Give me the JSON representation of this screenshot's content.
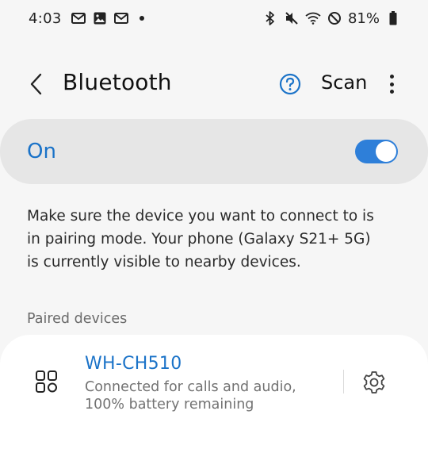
{
  "status_bar": {
    "time": "4:03",
    "left_icons": [
      "gmail-icon",
      "gallery-icon",
      "gmail-icon"
    ],
    "right_icons": [
      "bluetooth-icon",
      "mute-icon",
      "wifi-icon",
      "do-not-disturb-icon"
    ],
    "battery_percent": "81%"
  },
  "header": {
    "title": "Bluetooth",
    "scan_label": "Scan"
  },
  "master_toggle": {
    "label": "On",
    "state": "on",
    "accent_color": "#2e7fd9"
  },
  "description": "Make sure the device you want to connect to is in pairing mode. Your phone (Galaxy S21+ 5G) is currently visible to nearby devices.",
  "paired_section": {
    "header": "Paired devices",
    "devices": [
      {
        "name": "WH-CH510",
        "status": "Connected for calls and audio, 100% battery remaining",
        "icon": "headphones-category-icon"
      }
    ]
  },
  "colors": {
    "accent": "#1b73c8",
    "background": "#f6f6f6",
    "toggle_row": "#e6e6e6"
  }
}
